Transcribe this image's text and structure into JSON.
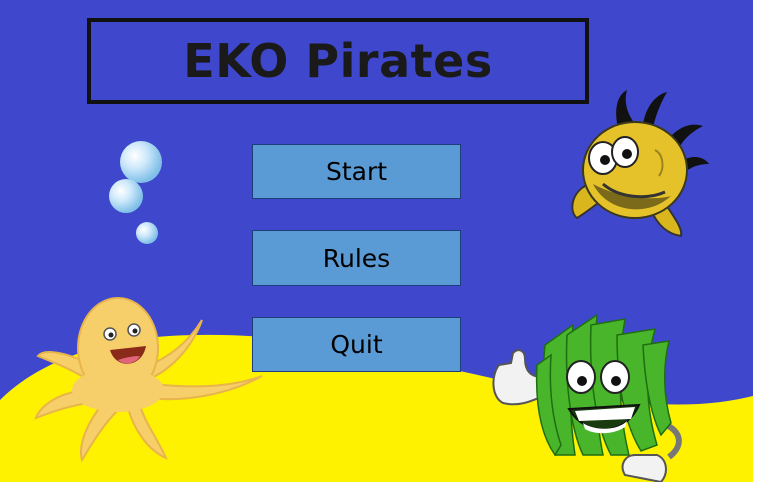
{
  "game": {
    "title": "EKO Pirates"
  },
  "menu": {
    "start_label": "Start",
    "rules_label": "Rules",
    "quit_label": "Quit"
  },
  "colors": {
    "water": "#3f48cc",
    "sand": "#fff200",
    "button_fill": "#5b9bd5",
    "button_border": "#1f3d7a",
    "title_border": "#111111"
  },
  "decorations": [
    "bubbles",
    "yellow-fish",
    "octopus",
    "seaweed-character"
  ]
}
